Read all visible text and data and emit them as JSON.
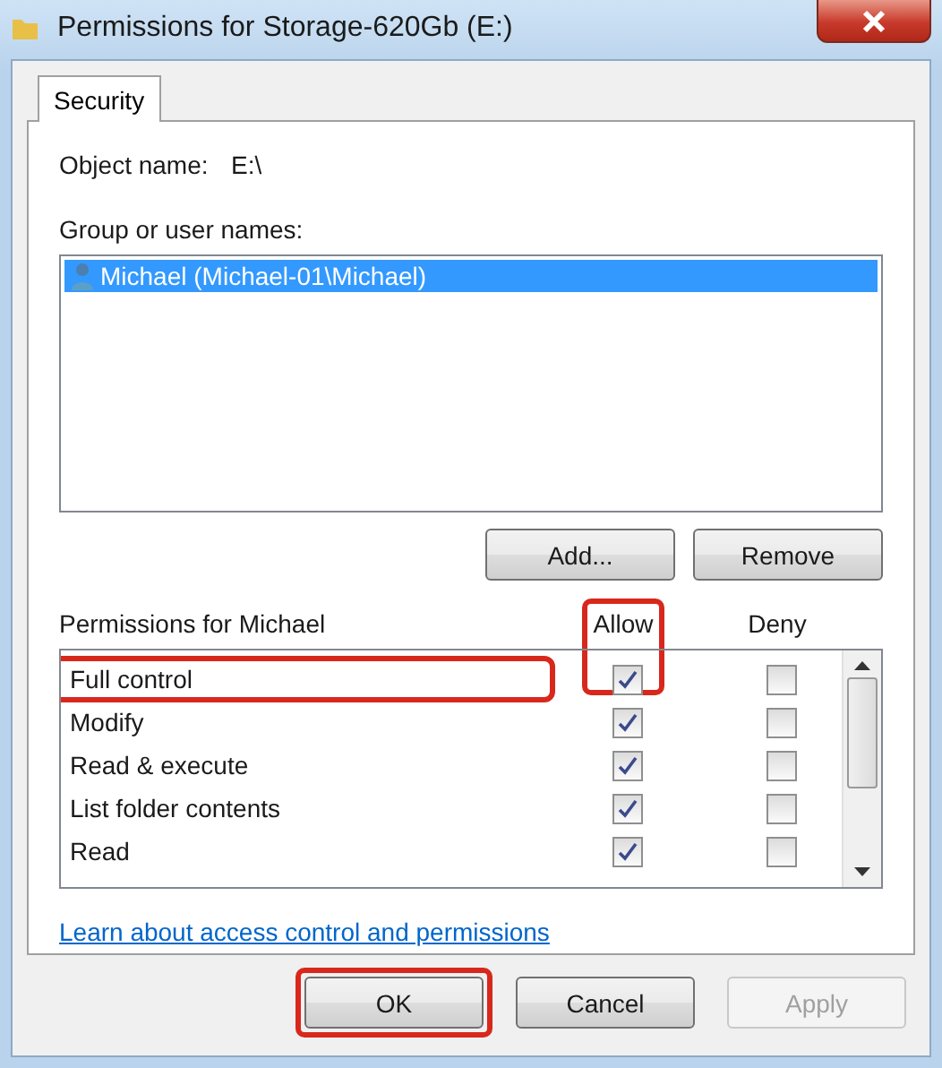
{
  "window": {
    "title": "Permissions for Storage-620Gb (E:)"
  },
  "tabs": [
    {
      "label": "Security",
      "selected": true
    }
  ],
  "object_name": {
    "label": "Object name:",
    "value": "E:\\"
  },
  "groups": {
    "label": "Group or user names:",
    "items": [
      {
        "name": "Michael (Michael-01\\Michael)",
        "selected": true
      }
    ]
  },
  "group_buttons": [
    "Add...",
    "Remove"
  ],
  "permissions": {
    "label": "Permissions for Michael",
    "allow_header": "Allow",
    "allow_highlighted": true,
    "deny_header": "Deny",
    "rows": [
      {
        "name": "Full control",
        "allow": true,
        "deny": false,
        "highlighted": true
      },
      {
        "name": "Modify",
        "allow": true,
        "deny": false,
        "highlighted": false
      },
      {
        "name": "Read & execute",
        "allow": true,
        "deny": false,
        "highlighted": false
      },
      {
        "name": "List folder contents",
        "allow": true,
        "deny": false,
        "highlighted": false
      },
      {
        "name": "Read",
        "allow": true,
        "deny": false,
        "highlighted": false
      }
    ]
  },
  "link": "Learn about access control and permissions",
  "buttons": [
    {
      "label": "OK",
      "disabled": false,
      "highlighted": true
    },
    {
      "label": "Cancel",
      "disabled": false,
      "highlighted": false
    },
    {
      "label": "Apply",
      "disabled": true,
      "highlighted": false
    }
  ]
}
